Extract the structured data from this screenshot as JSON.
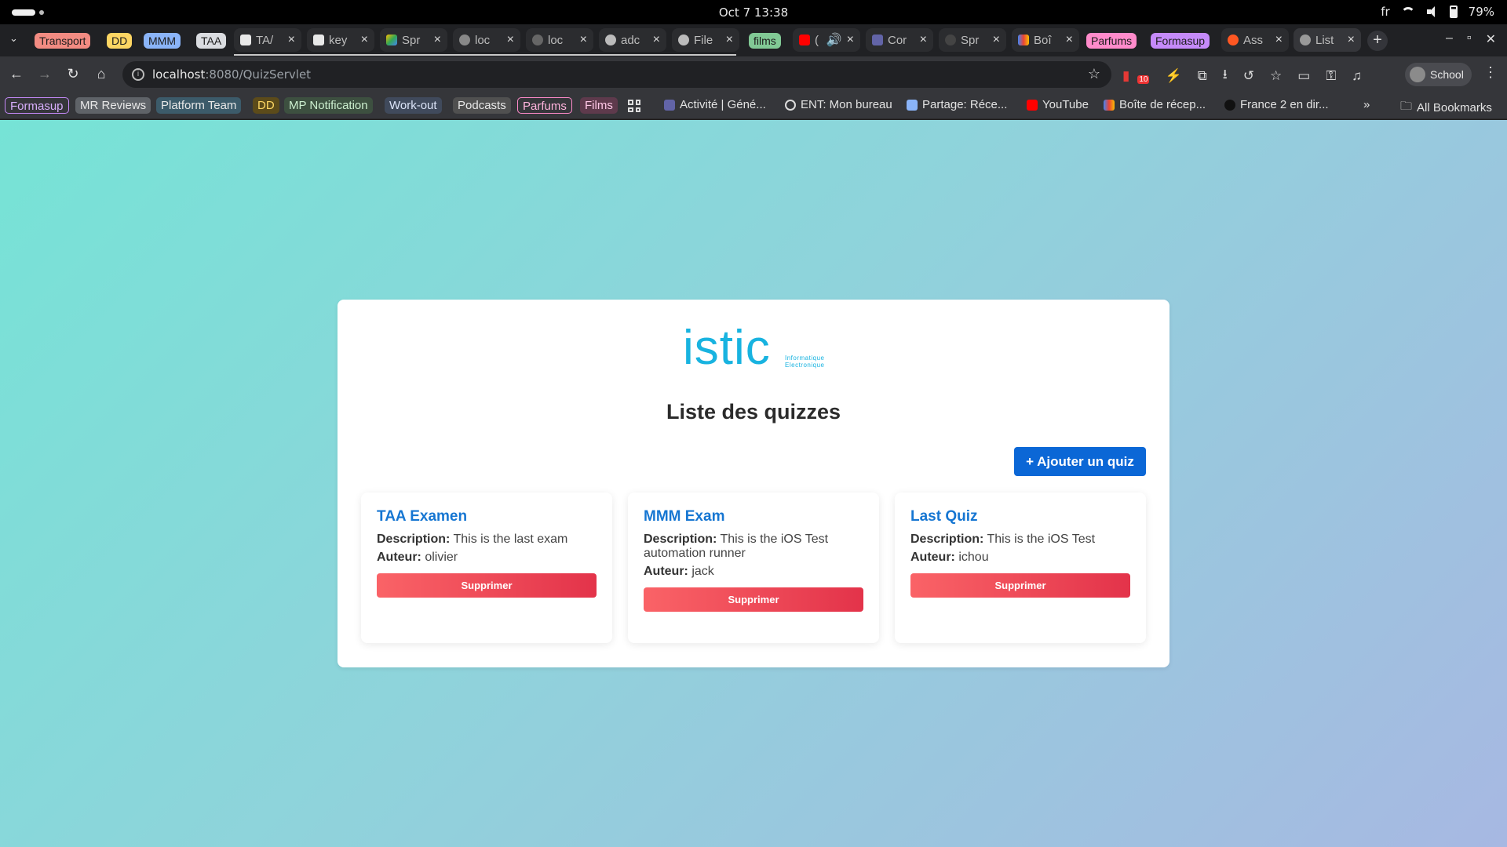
{
  "os": {
    "clock": "Oct 7  13:38",
    "lang": "fr",
    "battery": "79%"
  },
  "tabstrip": {
    "groups": [
      "Transport",
      "DD",
      "MMM",
      "TAA",
      "films",
      "Parfums",
      "Formasup"
    ],
    "tabs": [
      "TA/",
      "key",
      "Spr",
      "loc",
      "loc",
      "adc",
      "File",
      "(",
      "Cor",
      "Spr",
      "Boî",
      "Ass",
      "List"
    ]
  },
  "toolbar": {
    "url_host": "localhost",
    "url_path": ":8080/QuizServlet",
    "profile": "School",
    "ext_badge": "10"
  },
  "bookmarks": {
    "groups": [
      "Formasup",
      "MR Reviews",
      "Platform Team",
      "DD",
      "MP Notification",
      "Work-out",
      "Podcasts",
      "Parfums",
      "Films"
    ],
    "items": [
      "Activité | Géné...",
      "ENT: Mon bureau",
      "Partage: Réce...",
      "YouTube",
      "Boîte de récep...",
      "France 2 en dir..."
    ],
    "overflow": "»",
    "all": "All Bookmarks"
  },
  "page": {
    "logo": "istic",
    "logo_sub1": "Informatique",
    "logo_sub2": "Electronique",
    "title": "Liste des quizzes",
    "add_button": "+ Ajouter un quiz",
    "desc_label": "Description:",
    "author_label": "Auteur:",
    "delete_label": "Supprimer",
    "quizzes": [
      {
        "title": "TAA Examen",
        "description": "This is the last exam",
        "author": "olivier"
      },
      {
        "title": "MMM Exam",
        "description": "This is the iOS Test automation runner",
        "author": "jack"
      },
      {
        "title": "Last Quiz",
        "description": "This is the iOS Test",
        "author": "ichou"
      }
    ]
  },
  "colors": {
    "accent": "#0b67d6",
    "title_blue": "#1676d2",
    "delete_start": "#fa6367",
    "delete_end": "#e3334a",
    "logo": "#18b3e0"
  }
}
